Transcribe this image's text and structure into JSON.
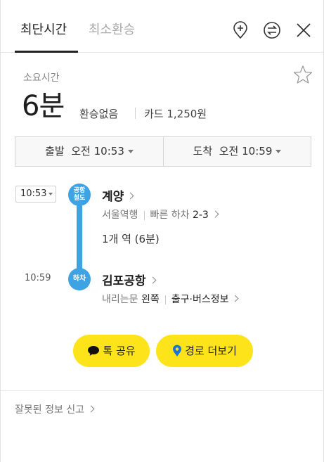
{
  "tabs": [
    {
      "label": "최단시간",
      "active": true
    },
    {
      "label": "최소환승",
      "active": false
    }
  ],
  "header_icons": [
    "add-location-icon",
    "swap-icon",
    "close-icon"
  ],
  "summary": {
    "duration_label": "소요시간",
    "duration": "6분",
    "transfer": "환승없음",
    "fare": "카드 1,250원"
  },
  "time_selector": {
    "departure": "출발  오전 10:53",
    "arrival": "도착  오전 10:59"
  },
  "route": {
    "start": {
      "time": "10:53",
      "badge": [
        "공항",
        "철도"
      ],
      "station": "계양",
      "direction": "서울역행",
      "fast_exit_label": "빠른 하차",
      "fast_exit_value": "2-3"
    },
    "ride_info": "1개 역 (6분)",
    "end": {
      "time": "10:59",
      "badge": "하차",
      "station": "김포공항",
      "door_label": "내리는문",
      "door_value": "왼쪽",
      "exit_info": "출구·버스정보"
    }
  },
  "buttons": {
    "talk_share": "톡 공유",
    "more_route": "경로 더보기"
  },
  "report": "잘못된 정보 신고",
  "colors": {
    "line": "#3da3e2",
    "button": "#fde31a"
  }
}
